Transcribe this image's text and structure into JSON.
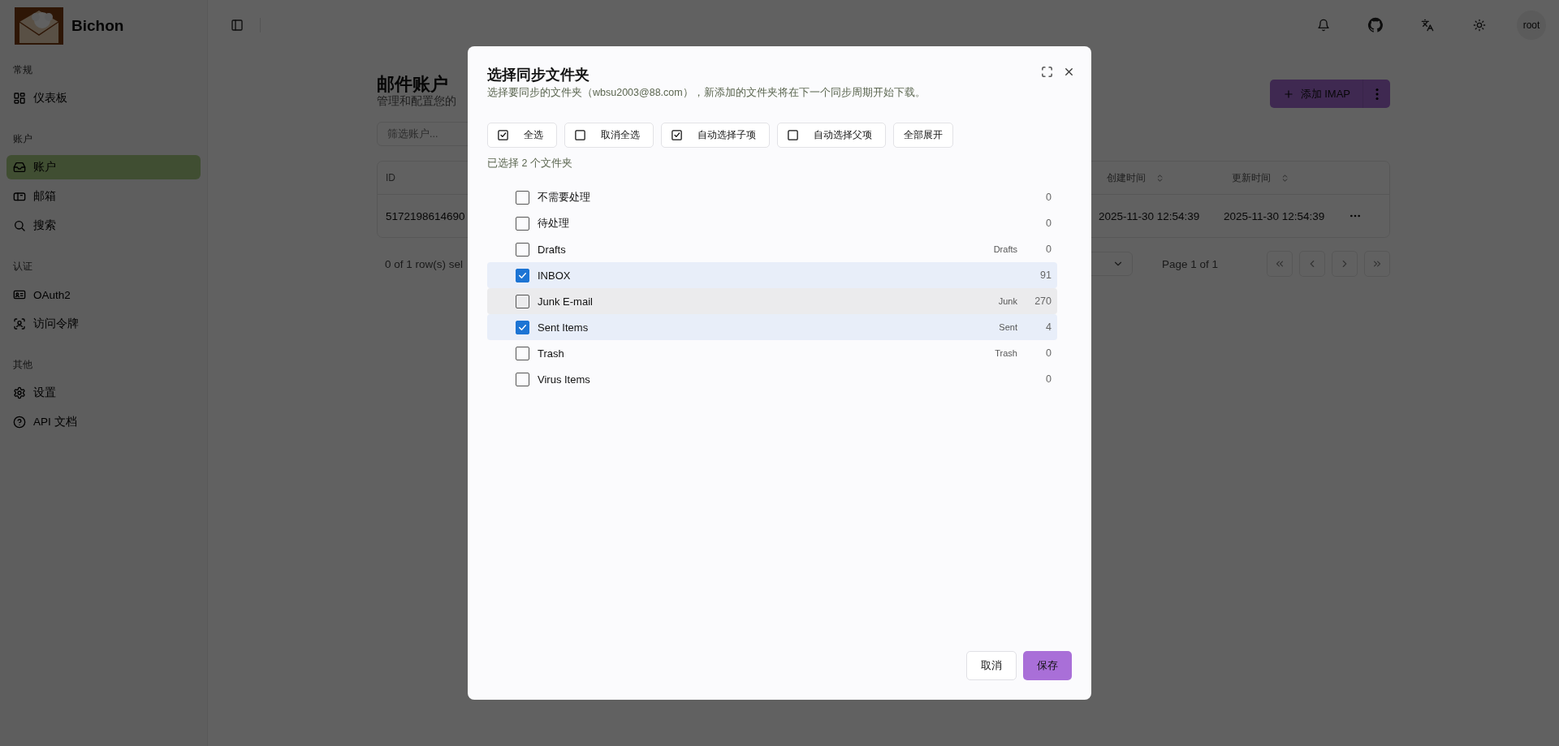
{
  "app": {
    "name": "Bichon"
  },
  "sidebar": {
    "sections": [
      {
        "label": "常规",
        "items": [
          {
            "label": "仪表板",
            "selected": false
          }
        ]
      },
      {
        "label": "账户",
        "items": [
          {
            "label": "账户",
            "selected": true
          },
          {
            "label": "邮箱",
            "selected": false
          },
          {
            "label": "搜索",
            "selected": false
          }
        ]
      },
      {
        "label": "认证",
        "items": [
          {
            "label": "OAuth2",
            "selected": false
          },
          {
            "label": "访问令牌",
            "selected": false
          }
        ]
      },
      {
        "label": "其他",
        "items": [
          {
            "label": "设置",
            "selected": false
          },
          {
            "label": "API 文档",
            "selected": false
          }
        ]
      }
    ]
  },
  "topbar": {
    "user": "root"
  },
  "page": {
    "title": "邮件账户",
    "subtitle": "管理和配置您的",
    "filter_placeholder": "筛选账户...",
    "add_button": "添加 IMAP",
    "table": {
      "columns": [
        "ID",
        "创建时间",
        "更新时间"
      ],
      "rows": [
        {
          "id": "5172198614690",
          "created": "2025-11-30 12:54:39",
          "updated": "2025-11-30 12:54:39"
        }
      ]
    },
    "selection_text": "0 of 1 row(s) sel",
    "page_info": "Page 1 of 1"
  },
  "dialog": {
    "title": "选择同步文件夹",
    "description": "选择要同步的文件夹（wbsu2003@88.com），新添加的文件夹将在下一个同步周期开始下载。",
    "actions": [
      {
        "label": "全选",
        "kind": "toggle",
        "checked": true
      },
      {
        "label": "取消全选",
        "kind": "toggle",
        "checked": false
      },
      {
        "label": "自动选择子项",
        "kind": "toggle",
        "checked": true
      },
      {
        "label": "自动选择父项",
        "kind": "toggle",
        "checked": false
      },
      {
        "label": "全部展开",
        "kind": "plain"
      }
    ],
    "selected_count": "已选择 2 个文件夹",
    "folders": [
      {
        "name": "不需要处理",
        "count": "0",
        "checked": false,
        "hovered": false
      },
      {
        "name": "待处理",
        "count": "0",
        "checked": false,
        "hovered": false
      },
      {
        "name": "Drafts",
        "role": "Drafts",
        "count": "0",
        "checked": false,
        "hovered": false
      },
      {
        "name": "INBOX",
        "count": "91",
        "checked": true,
        "hovered": false
      },
      {
        "name": "Junk E-mail",
        "role": "Junk",
        "count": "270",
        "checked": false,
        "hovered": true
      },
      {
        "name": "Sent Items",
        "role": "Sent",
        "count": "4",
        "checked": true,
        "hovered": false
      },
      {
        "name": "Trash",
        "role": "Trash",
        "count": "0",
        "checked": false,
        "hovered": false
      },
      {
        "name": "Virus Items",
        "count": "0",
        "checked": false,
        "hovered": false
      }
    ],
    "cancel": "取消",
    "save": "保存"
  }
}
